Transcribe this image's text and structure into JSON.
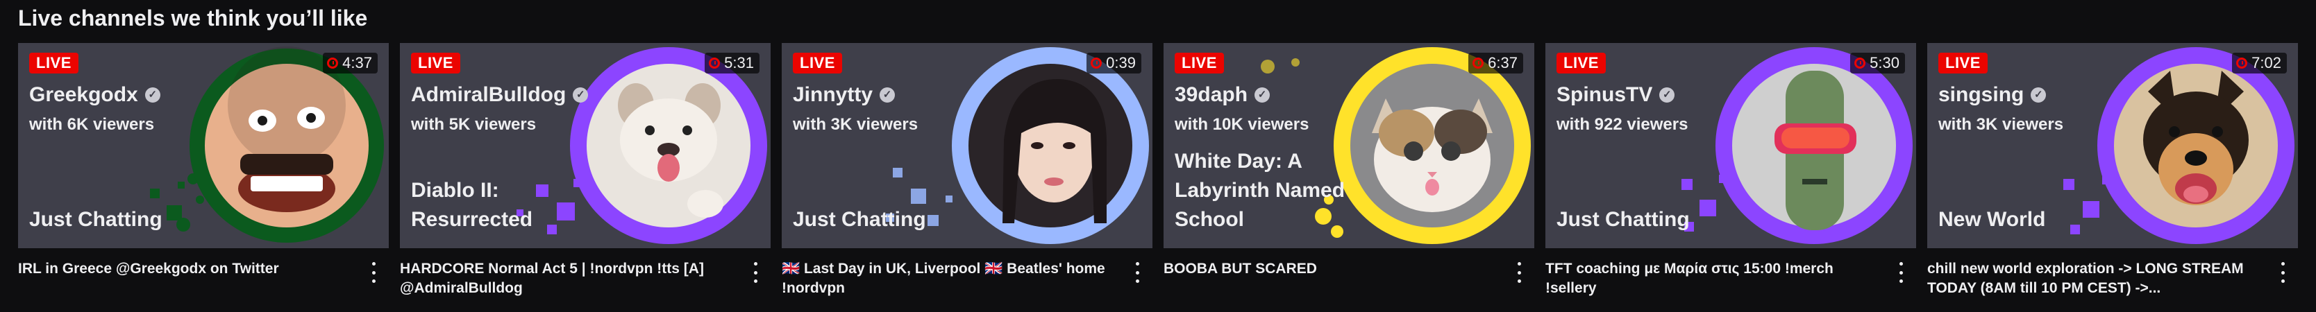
{
  "section": {
    "title": "Live channels we think you’ll like"
  },
  "cards": [
    {
      "live_label": "LIVE",
      "uptime": "4:37",
      "streamer": "Greekgodx",
      "viewers": "with 6K viewers",
      "category": "Just Chatting",
      "title": "IRL in Greece @Greekgodx on Twitter",
      "ring_color": "#0b5a1e",
      "avatar_icon": "face-icon"
    },
    {
      "live_label": "LIVE",
      "uptime": "5:31",
      "streamer": "AdmiralBulldog",
      "viewers": "with 5K viewers",
      "category": "Diablo II: Resurrected",
      "title": "HARDCORE Normal Act 5 | !nordvpn !tts [A] @AdmiralBulldog",
      "ring_color": "#8c45ff",
      "avatar_icon": "puppy-icon"
    },
    {
      "live_label": "LIVE",
      "uptime": "0:39",
      "streamer": "Jinnytty",
      "viewers": "with 3K viewers",
      "category": "Just Chatting",
      "title": "🇬🇧 Last Day in UK, Liverpool 🇬🇧 Beatles' home !nordvpn",
      "ring_color": "#9ab8ff",
      "avatar_icon": "portrait-icon"
    },
    {
      "live_label": "LIVE",
      "uptime": "6:37",
      "streamer": "39daph",
      "viewers": "with 10K viewers",
      "category": "White Day: A Labyrinth Named School",
      "title": "BOOBA BUT SCARED",
      "ring_color": "#ffe22a",
      "avatar_icon": "cat-icon"
    },
    {
      "live_label": "LIVE",
      "uptime": "5:30",
      "streamer": "SpinusTV",
      "viewers": "with 922 viewers",
      "category": "Just Chatting",
      "title": "TFT coaching με Μαρία στις 15:00 !merch !sellery",
      "ring_color": "#8c45ff",
      "avatar_icon": "sunglasses-icon"
    },
    {
      "live_label": "LIVE",
      "uptime": "7:02",
      "streamer": "singsing",
      "viewers": "with 3K viewers",
      "category": "New World",
      "title": "chill new world exploration -> LONG STREAM TODAY (8AM till 10 PM CEST) ->...",
      "ring_color": "#8c45ff",
      "avatar_icon": "dog-icon"
    }
  ]
}
